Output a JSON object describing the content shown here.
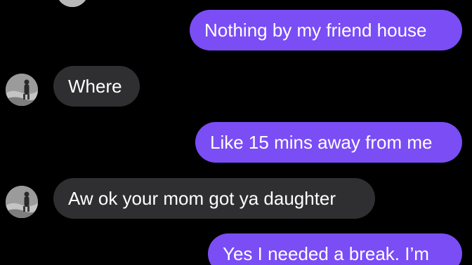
{
  "messages": [
    {
      "side": "sent",
      "text": "Nothing by my friend house"
    },
    {
      "side": "received",
      "text": "Where"
    },
    {
      "side": "sent",
      "text": "Like 15 mins away from me"
    },
    {
      "side": "received",
      "text": "Aw ok your mom got ya daughter"
    },
    {
      "side": "sent",
      "text": "Yes I needed a break. I’m"
    }
  ],
  "colors": {
    "background": "#000000",
    "sent_bubble": "#7A4DF5",
    "received_bubble": "#2F2F31",
    "text": "#FFFFFF"
  },
  "icons": {
    "contact_avatar": "contact-avatar-photo"
  }
}
